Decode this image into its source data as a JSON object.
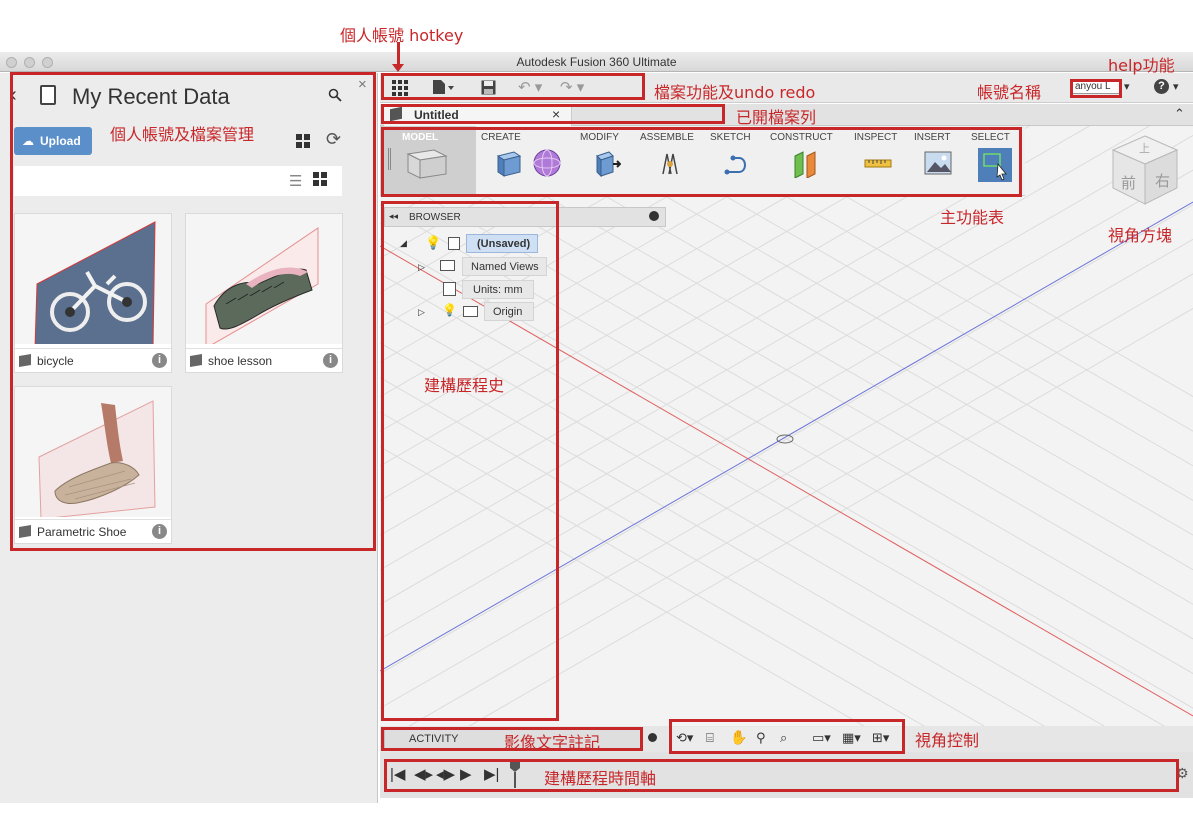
{
  "annotations": {
    "hotkey": "個人帳號 hotkey",
    "file_undo": "檔案功能及undo redo",
    "account_name": "帳號名稱",
    "help": "help功能",
    "open_tabs": "已開檔案列",
    "account_files": "個人帳號及檔案管理",
    "main_menu": "主功能表",
    "view_cube": "視角方塊",
    "history": "建構歷程史",
    "text_note": "影像文字註記",
    "view_control": "視角控制",
    "timeline": "建構歷程時間軸"
  },
  "window": {
    "title": "Autodesk Fusion 360 Ultimate"
  },
  "left_panel": {
    "back": "‹",
    "title": "My Recent Data",
    "upload_label": "Upload",
    "close": "×",
    "items": [
      {
        "name": "bicycle"
      },
      {
        "name": "shoe lesson"
      },
      {
        "name": "Parametric Shoe"
      }
    ]
  },
  "header": {
    "user": "anyou L",
    "user_caret": "▾",
    "help_caret": "▾"
  },
  "tabs": [
    {
      "label": "Untitled",
      "close": "×"
    }
  ],
  "toolbar": {
    "groups": [
      {
        "label": "MODEL"
      },
      {
        "label": "CREATE"
      },
      {
        "label": "MODIFY"
      },
      {
        "label": "ASSEMBLE"
      },
      {
        "label": "SKETCH"
      },
      {
        "label": "CONSTRUCT"
      },
      {
        "label": "INSPECT"
      },
      {
        "label": "INSERT"
      },
      {
        "label": "SELECT"
      }
    ]
  },
  "browser": {
    "title": "BROWSER",
    "root": "(Unsaved)",
    "items": [
      "Named Views",
      "Units: mm",
      "Origin"
    ]
  },
  "view_cube": {
    "front": "前",
    "right": "右",
    "top": "上"
  },
  "activity": {
    "label": "ACTIVITY"
  },
  "colors": {
    "annotation": "#c8272a",
    "accent": "#5a8fc9",
    "selected": "#cfe0f5"
  }
}
